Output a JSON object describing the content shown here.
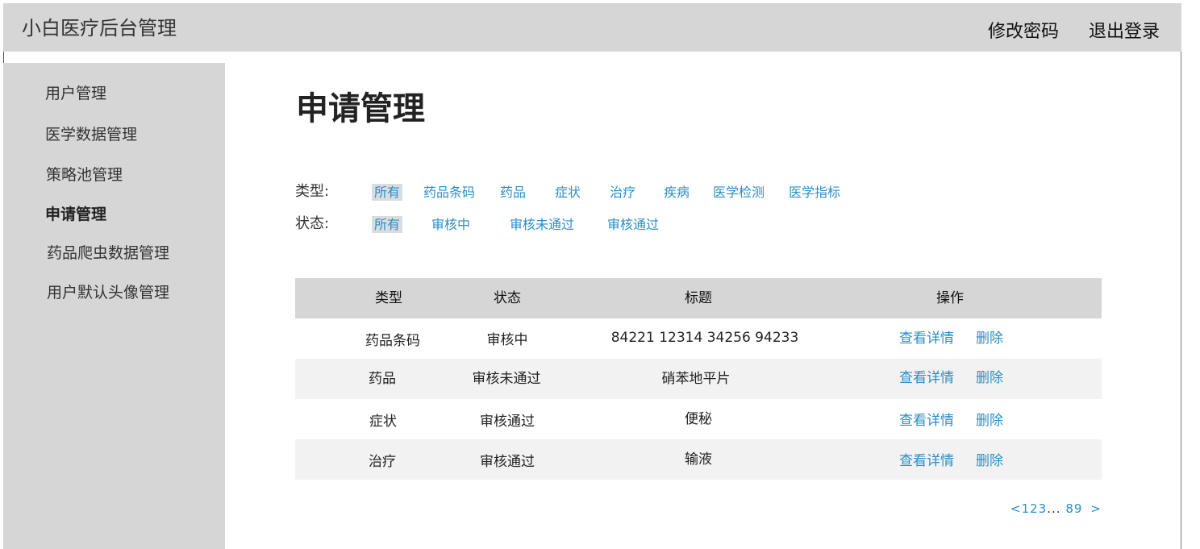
{
  "header": {
    "title": "小白医疗后台管理",
    "change_password": "修改密码",
    "logout": "退出登录"
  },
  "sidebar": {
    "items": [
      {
        "label": "用户管理"
      },
      {
        "label": "医学数据管理"
      },
      {
        "label": "策略池管理"
      },
      {
        "label": "申请管理",
        "active": true
      },
      {
        "label": "药品爬虫数据管理"
      },
      {
        "label": "用户默认头像管理"
      }
    ]
  },
  "main": {
    "title": "申请管理",
    "filters": {
      "type": {
        "label": "类型:",
        "options": [
          "所有",
          "药品条码",
          "药品",
          "症状",
          "治疗",
          "疾病",
          "医学检测",
          "医学指标"
        ],
        "selected": "所有"
      },
      "status": {
        "label": "状态:",
        "options": [
          "所有",
          "审核中",
          "审核未通过",
          "审核通过"
        ],
        "selected": "所有"
      }
    },
    "table": {
      "headers": [
        "类型",
        "状态",
        "标题",
        "操作"
      ],
      "rows": [
        {
          "type": "药品条码",
          "status": "审核中",
          "title": "84221 12314 34256 94233",
          "view": "查看详情",
          "delete": "删除"
        },
        {
          "type": "药品",
          "status": "审核未通过",
          "title": "硝苯地平片",
          "view": "查看详情",
          "delete": "删除"
        },
        {
          "type": "症状",
          "status": "审核通过",
          "title": "便秘",
          "view": "查看详情",
          "delete": "删除"
        },
        {
          "type": "治疗",
          "status": "审核通过",
          "title": "输液",
          "view": "查看详情",
          "delete": "删除"
        }
      ]
    },
    "pagination": {
      "prev": "<",
      "pages_start": [
        "1",
        "2",
        "3"
      ],
      "ellipsis": "...",
      "pages_end": [
        "8",
        "9"
      ],
      "next": ">"
    }
  },
  "colors": {
    "header_bg": "#d6d6d6",
    "sidebar_bg": "#d6d6d6",
    "link": "#2a8fc7",
    "row_alt": "#f2f2f2",
    "chip_selected_bg": "#d9dde0"
  }
}
